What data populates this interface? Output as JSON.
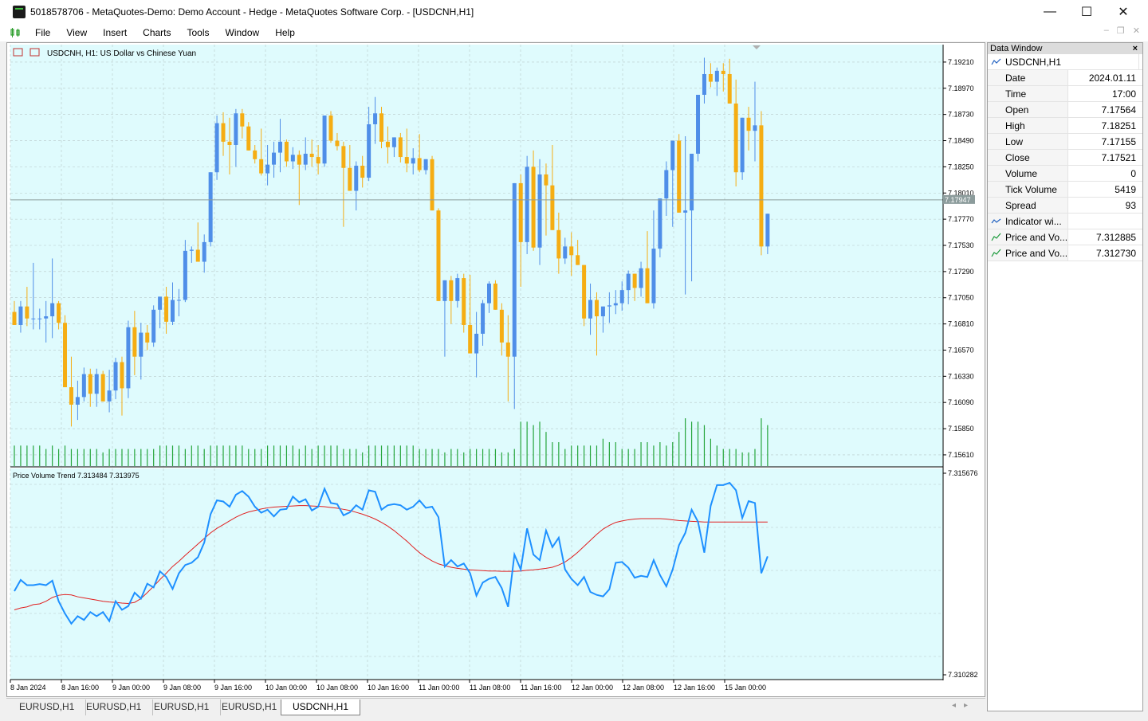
{
  "window": {
    "title": "5018578706 - MetaQuotes-Demo: Demo Account - Hedge - MetaQuotes Software Corp. - [USDCNH,H1]",
    "minimize": "—",
    "maximize": "☐",
    "close": "✕"
  },
  "menu": [
    "File",
    "View",
    "Insert",
    "Charts",
    "Tools",
    "Window",
    "Help"
  ],
  "chart": {
    "header_label": "USDCNH, H1:  US Dollar vs Chinese Yuan",
    "indicator_label": "Price Volume Trend 7.313484 7.313975",
    "current_price": "7.17947",
    "price_axis_labels": [
      "7.19210",
      "7.18970",
      "7.18730",
      "7.18490",
      "7.18250",
      "7.18010",
      "7.17770",
      "7.17530",
      "7.17290",
      "7.17050",
      "7.16810",
      "7.16570",
      "7.16330",
      "7.16090",
      "7.15850",
      "7.15610"
    ],
    "indicator_axis_labels": [
      "7.315676",
      "7.310282"
    ],
    "time_axis_labels": [
      "8 Jan 2024",
      "8 Jan 16:00",
      "9 Jan 00:00",
      "9 Jan 08:00",
      "9 Jan 16:00",
      "10 Jan 00:00",
      "10 Jan 08:00",
      "10 Jan 16:00",
      "11 Jan 00:00",
      "11 Jan 08:00",
      "11 Jan 16:00",
      "12 Jan 00:00",
      "12 Jan 08:00",
      "12 Jan 16:00",
      "15 Jan 00:00"
    ],
    "colors": {
      "background": "#dffbfd",
      "bull": "#4f8ee8",
      "bear": "#f5ad13",
      "volume": "#25a53b",
      "pvt_line": "#1e90ff",
      "pvt_signal": "#e02020",
      "grid": "#b8c8c8"
    }
  },
  "chart_data": {
    "type": "candlestick",
    "symbol": "USDCNH",
    "timeframe": "H1",
    "ylim": [
      7.155,
      7.1937
    ],
    "candles_ohlc": [
      [
        7.1692,
        7.1702,
        7.1684,
        7.168
      ],
      [
        7.168,
        7.1702,
        7.1673,
        7.1697
      ],
      [
        7.1697,
        7.1715,
        7.1679,
        7.1686
      ],
      [
        7.1686,
        7.1737,
        7.1676,
        7.1686
      ],
      [
        7.1686,
        7.1695,
        7.1676,
        7.1686
      ],
      [
        7.1686,
        7.1702,
        7.1664,
        7.1688
      ],
      [
        7.1688,
        7.1741,
        7.1668,
        7.17
      ],
      [
        7.17,
        7.1702,
        7.1676,
        7.1682
      ],
      [
        7.1682,
        7.1689,
        7.1628,
        7.1623
      ],
      [
        7.1623,
        7.1651,
        7.1587,
        7.1607
      ],
      [
        7.1607,
        7.1629,
        7.1593,
        7.1614
      ],
      [
        7.1614,
        7.1641,
        7.161,
        7.1635
      ],
      [
        7.1635,
        7.164,
        7.1605,
        7.1617
      ],
      [
        7.1617,
        7.164,
        7.1605,
        7.1635
      ],
      [
        7.1635,
        7.1638,
        7.161,
        7.161
      ],
      [
        7.161,
        7.1639,
        7.16,
        7.162
      ],
      [
        7.162,
        7.165,
        7.1612,
        7.1646
      ],
      [
        7.1646,
        7.1651,
        7.1597,
        7.1622
      ],
      [
        7.1622,
        7.1684,
        7.1613,
        7.1678
      ],
      [
        7.1678,
        7.1693,
        7.1634,
        7.1651
      ],
      [
        7.1651,
        7.1682,
        7.163,
        7.1673
      ],
      [
        7.1673,
        7.168,
        7.1657,
        7.1664
      ],
      [
        7.1664,
        7.1698,
        7.166,
        7.1694
      ],
      [
        7.1694,
        7.1706,
        7.1677,
        7.1706
      ],
      [
        7.1706,
        7.1715,
        7.1672,
        7.1683
      ],
      [
        7.1683,
        7.1719,
        7.168,
        7.1703
      ],
      [
        7.1703,
        7.1713,
        7.1688,
        7.1703
      ],
      [
        7.1703,
        7.1758,
        7.1701,
        7.1748
      ],
      [
        7.1748,
        7.1752,
        7.1737,
        7.1749
      ],
      [
        7.1749,
        7.1774,
        7.1738,
        7.1738
      ],
      [
        7.1738,
        7.1763,
        7.1728,
        7.1756
      ],
      [
        7.1756,
        7.182,
        7.1752,
        7.182
      ],
      [
        7.182,
        7.1872,
        7.1813,
        7.1865
      ],
      [
        7.1865,
        7.1875,
        7.1835,
        7.1848
      ],
      [
        7.1848,
        7.187,
        7.1818,
        7.1845
      ],
      [
        7.1845,
        7.1878,
        7.1825,
        7.1874
      ],
      [
        7.1874,
        7.1878,
        7.1851,
        7.1862
      ],
      [
        7.1862,
        7.1866,
        7.184,
        7.184
      ],
      [
        7.184,
        7.1845,
        7.1828,
        7.1832
      ],
      [
        7.1832,
        7.186,
        7.1817,
        7.1819
      ],
      [
        7.1819,
        7.1845,
        7.1808,
        7.1827
      ],
      [
        7.1827,
        7.1848,
        7.1815,
        7.1838
      ],
      [
        7.1838,
        7.1869,
        7.182,
        7.1848
      ],
      [
        7.1848,
        7.185,
        7.1825,
        7.183
      ],
      [
        7.183,
        7.1843,
        7.1823,
        7.1836
      ],
      [
        7.1836,
        7.184,
        7.179,
        7.1827
      ],
      [
        7.1827,
        7.1852,
        7.1822,
        7.1837
      ],
      [
        7.1837,
        7.185,
        7.1825,
        7.1834
      ],
      [
        7.1834,
        7.1845,
        7.1818,
        7.1828
      ],
      [
        7.1828,
        7.1872,
        7.1825,
        7.1872
      ],
      [
        7.1872,
        7.1876,
        7.1847,
        7.1849
      ],
      [
        7.1849,
        7.1856,
        7.184,
        7.1844
      ],
      [
        7.1844,
        7.1848,
        7.177,
        7.1824
      ],
      [
        7.1824,
        7.1845,
        7.1818,
        7.1803
      ],
      [
        7.1803,
        7.183,
        7.1785,
        7.1826
      ],
      [
        7.1826,
        7.1835,
        7.1806,
        7.1815
      ],
      [
        7.1815,
        7.188,
        7.1812,
        7.1864
      ],
      [
        7.1864,
        7.1889,
        7.1846,
        7.1874
      ],
      [
        7.1874,
        7.188,
        7.1842,
        7.1848
      ],
      [
        7.1848,
        7.1862,
        7.1828,
        7.1843
      ],
      [
        7.1843,
        7.1852,
        7.1834,
        7.1852
      ],
      [
        7.1852,
        7.1856,
        7.1829,
        7.1834
      ],
      [
        7.1834,
        7.186,
        7.182,
        7.1828
      ],
      [
        7.1828,
        7.1842,
        7.1818,
        7.1833
      ],
      [
        7.1833,
        7.1855,
        7.182,
        7.1822
      ],
      [
        7.1822,
        7.183,
        7.1818,
        7.1832
      ],
      [
        7.1832,
        7.1835,
        7.1785,
        7.1785
      ],
      [
        7.1785,
        7.1787,
        7.1718,
        7.1702
      ],
      [
        7.1702,
        7.1721,
        7.1651,
        7.1721
      ],
      [
        7.1721,
        7.1725,
        7.1681,
        7.1702
      ],
      [
        7.1702,
        7.1727,
        7.1696,
        7.1723
      ],
      [
        7.1723,
        7.1727,
        7.1673,
        7.168
      ],
      [
        7.168,
        7.1726,
        7.1666,
        7.1654
      ],
      [
        7.1654,
        7.1692,
        7.1632,
        7.1672
      ],
      [
        7.1672,
        7.1703,
        7.1661,
        7.17
      ],
      [
        7.17,
        7.172,
        7.1691,
        7.1718
      ],
      [
        7.1718,
        7.1721,
        7.1696,
        7.1694
      ],
      [
        7.1694,
        7.17,
        7.1652,
        7.1664
      ],
      [
        7.1664,
        7.1689,
        7.161,
        7.1651
      ],
      [
        7.1651,
        7.181,
        7.1603,
        7.181
      ],
      [
        7.181,
        7.1818,
        7.1715,
        7.1756
      ],
      [
        7.1756,
        7.1835,
        7.1745,
        7.1825
      ],
      [
        7.1825,
        7.184,
        7.1748,
        7.1751
      ],
      [
        7.1751,
        7.1832,
        7.1735,
        7.1818
      ],
      [
        7.1818,
        7.1828,
        7.1762,
        7.1808
      ],
      [
        7.1808,
        7.1845,
        7.1773,
        7.1767
      ],
      [
        7.1767,
        7.1783,
        7.1727,
        7.1741
      ],
      [
        7.1741,
        7.176,
        7.1736,
        7.1752
      ],
      [
        7.1752,
        7.1765,
        7.1725,
        7.1744
      ],
      [
        7.1744,
        7.1758,
        7.1735,
        7.1735
      ],
      [
        7.1735,
        7.1735,
        7.1679,
        7.1686
      ],
      [
        7.1686,
        7.1718,
        7.1671,
        7.1703
      ],
      [
        7.1703,
        7.171,
        7.1652,
        7.1688
      ],
      [
        7.1688,
        7.1697,
        7.1673,
        7.1697
      ],
      [
        7.1697,
        7.171,
        7.1682,
        7.1698
      ],
      [
        7.1698,
        7.1712,
        7.169,
        7.17
      ],
      [
        7.17,
        7.172,
        7.1693,
        7.1712
      ],
      [
        7.1712,
        7.173,
        7.1699,
        7.1727
      ],
      [
        7.1727,
        7.172,
        7.1702,
        7.1714
      ],
      [
        7.1714,
        7.1738,
        7.1706,
        7.1732
      ],
      [
        7.1732,
        7.1766,
        7.17,
        7.17
      ],
      [
        7.17,
        7.1785,
        7.1695,
        7.175
      ],
      [
        7.175,
        7.1795,
        7.1742,
        7.1796
      ],
      [
        7.1796,
        7.183,
        7.178,
        7.1822
      ],
      [
        7.1822,
        7.1835,
        7.177,
        7.1849
      ],
      [
        7.1849,
        7.1855,
        7.1795,
        7.1783
      ],
      [
        7.1783,
        7.1853,
        7.1708,
        7.1785
      ],
      [
        7.1785,
        7.183,
        7.172,
        7.1837
      ],
      [
        7.1837,
        7.1891,
        7.183,
        7.1891
      ],
      [
        7.1891,
        7.1925,
        7.1883,
        7.191
      ],
      [
        7.191,
        7.192,
        7.1898,
        7.1903
      ],
      [
        7.1903,
        7.1916,
        7.189,
        7.1913
      ],
      [
        7.1913,
        7.192,
        7.1894,
        7.191
      ],
      [
        7.191,
        7.1924,
        7.1883,
        7.1883
      ],
      [
        7.1883,
        7.1905,
        7.1807,
        7.182
      ],
      [
        7.182,
        7.1855,
        7.1813,
        7.187
      ],
      [
        7.187,
        7.188,
        7.184,
        7.1858
      ],
      [
        7.1858,
        7.1903,
        7.183,
        7.1863
      ],
      [
        7.1863,
        7.1876,
        7.1744,
        7.1752
      ],
      [
        7.1752,
        7.1782,
        7.1745,
        7.1782
      ]
    ],
    "volumes": [
      6,
      6,
      6,
      6,
      6,
      5,
      6,
      5,
      6,
      5,
      5,
      5,
      5,
      5,
      4,
      5,
      5,
      5,
      5,
      5,
      5,
      5,
      5,
      6,
      6,
      6,
      6,
      5,
      6,
      6,
      5,
      6,
      6,
      6,
      6,
      6,
      6,
      5,
      5,
      5,
      6,
      6,
      6,
      6,
      6,
      5,
      6,
      5,
      6,
      6,
      6,
      6,
      5,
      5,
      5,
      4,
      6,
      6,
      6,
      6,
      6,
      6,
      6,
      6,
      5,
      5,
      5,
      5,
      4,
      5,
      5,
      4,
      5,
      5,
      5,
      5,
      5,
      4,
      4,
      5,
      13,
      13,
      12,
      13,
      10,
      7,
      7,
      5,
      6,
      6,
      6,
      6,
      6,
      8,
      7,
      7,
      5,
      5,
      5,
      7,
      7,
      6,
      7,
      6,
      7,
      10,
      14,
      13,
      13,
      12,
      8,
      6,
      5,
      5,
      5,
      4,
      4,
      5,
      14,
      12
    ],
    "pvt": [
      7.31252,
      7.31282,
      7.31268,
      7.31268,
      7.31271,
      7.31268,
      7.3128,
      7.31225,
      7.31192,
      7.31165,
      7.31185,
      7.31175,
      7.31196,
      7.31185,
      7.31196,
      7.31172,
      7.31225,
      7.31202,
      7.31212,
      7.31248,
      7.31232,
      7.31272,
      7.31262,
      7.31305,
      7.3129,
      7.31258,
      7.313,
      7.31322,
      7.31328,
      7.31343,
      7.31382,
      7.31458,
      7.31495,
      7.31492,
      7.31478,
      7.3151,
      7.3152,
      7.31505,
      7.31478,
      7.31462,
      7.3147,
      7.31452,
      7.3147,
      7.31472,
      7.31505,
      7.3149,
      7.31498,
      7.31468,
      7.31478,
      7.31526,
      7.31488,
      7.31485,
      7.31455,
      7.31463,
      7.31482,
      7.3147,
      7.31522,
      7.31518,
      7.3147,
      7.31482,
      7.31485,
      7.31482,
      7.3147,
      7.31478,
      7.31495,
      7.31475,
      7.31478,
      7.3145,
      7.31318,
      7.31335,
      7.31318,
      7.31326,
      7.313,
      7.3124,
      7.31275,
      7.31285,
      7.3129,
      7.3126,
      7.3121,
      7.3135,
      7.3131,
      7.3142,
      7.3135,
      7.31335,
      7.31414,
      7.3137,
      7.31395,
      7.3131,
      7.31285,
      7.31268,
      7.3129,
      7.3125,
      7.31242,
      7.31238,
      7.31257,
      7.31328,
      7.3133,
      7.31315,
      7.31288,
      7.31293,
      7.3129,
      7.31335,
      7.31295,
      7.31265,
      7.3131,
      7.31375,
      7.31408,
      7.3147,
      7.31438,
      7.31355,
      7.3148,
      7.31536,
      7.31536,
      7.31542,
      7.31522,
      7.31448,
      7.31493,
      7.31488,
      7.313,
      7.31345
    ],
    "pvt_signal": [
      7.31202,
      7.31207,
      7.3121,
      7.31216,
      7.31218,
      7.31225,
      7.31235,
      7.31241,
      7.31243,
      7.31242,
      7.31237,
      7.31234,
      7.31231,
      7.31228,
      7.31225,
      7.31223,
      7.31222,
      7.3122,
      7.31219,
      7.31222,
      7.31232,
      7.31248,
      7.31265,
      7.31283,
      7.313,
      7.31318,
      7.31332,
      7.31348,
      7.31363,
      7.31378,
      7.31393,
      7.31408,
      7.3142,
      7.3143,
      7.3144,
      7.3145,
      7.31458,
      7.31464,
      7.31468,
      7.31472,
      7.31475,
      7.31477,
      7.31478,
      7.31479,
      7.3148,
      7.31481,
      7.31481,
      7.3148,
      7.31479,
      7.31478,
      7.31476,
      7.31474,
      7.31471,
      7.31468,
      7.31463,
      7.31458,
      7.31452,
      7.31445,
      7.31436,
      7.31426,
      7.31414,
      7.314,
      7.31386,
      7.3137,
      7.31355,
      7.31343,
      7.31333,
      7.31325,
      7.3132,
      7.31316,
      7.31313,
      7.31311,
      7.31309,
      7.31308,
      7.31307,
      7.31306,
      7.31306,
      7.31305,
      7.31305,
      7.31305,
      7.31306,
      7.31308,
      7.31309,
      7.31311,
      7.31313,
      7.31316,
      7.31322,
      7.3133,
      7.31342,
      7.31356,
      7.31372,
      7.31388,
      7.31404,
      7.31418,
      7.31428,
      7.31436,
      7.3144,
      7.31443,
      7.31445,
      7.31446,
      7.31446,
      7.31446,
      7.31446,
      7.31445,
      7.31443,
      7.31441,
      7.3144,
      7.31439,
      7.31438,
      7.31437,
      7.31437,
      7.31437,
      7.31437,
      7.31437,
      7.31437,
      7.31437,
      7.31437,
      7.31437,
      7.31437,
      7.31437
    ],
    "pvt_ylim": [
      7.310282,
      7.315676
    ]
  },
  "data_window": {
    "title": "Data Window",
    "close": "×",
    "symbol": "USDCNH,H1",
    "rows": [
      {
        "label": "Date",
        "value": "2024.01.11"
      },
      {
        "label": "Time",
        "value": "17:00"
      },
      {
        "label": "Open",
        "value": "7.17564"
      },
      {
        "label": "High",
        "value": "7.18251"
      },
      {
        "label": "Low",
        "value": "7.17155"
      },
      {
        "label": "Close",
        "value": "7.17521"
      },
      {
        "label": "Volume",
        "value": "0"
      },
      {
        "label": "Tick Volume",
        "value": "5419"
      },
      {
        "label": "Spread",
        "value": "93"
      }
    ],
    "indicator_rows": [
      {
        "label": "Indicator wi...",
        "value": ""
      },
      {
        "label": "Price and Vo...",
        "value": "7.312885"
      },
      {
        "label": "Price and Vo...",
        "value": "7.312730"
      }
    ]
  },
  "tabs": [
    "EURUSD,H1",
    "EURUSD,H1",
    "EURUSD,H1",
    "EURUSD,H1",
    "USDCNH,H1"
  ],
  "active_tab": 4
}
